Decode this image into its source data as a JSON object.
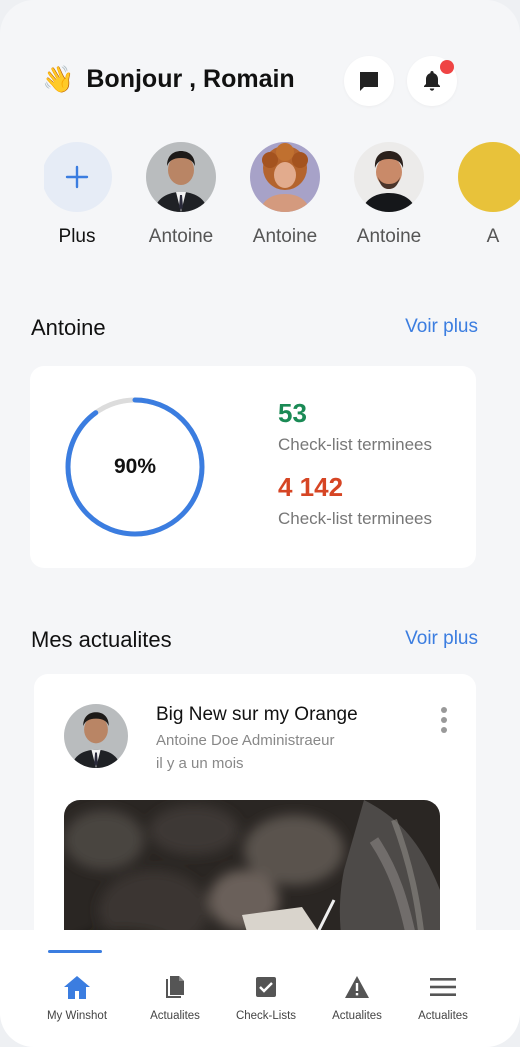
{
  "header": {
    "wave_emoji": "👋",
    "greeting": "Bonjour , Romain",
    "notification_dot_color": "#ef4444"
  },
  "stories": [
    {
      "label": "Plus",
      "type": "add"
    },
    {
      "label": "Antoine",
      "type": "avatar"
    },
    {
      "label": "Antoine",
      "type": "avatar"
    },
    {
      "label": "Antoine",
      "type": "avatar"
    },
    {
      "label": "A",
      "type": "avatar"
    }
  ],
  "stats_section": {
    "title": "Antoine",
    "see_more": "Voir plus",
    "progress_percent": 90,
    "progress_label": "90%",
    "stat1_value": "53",
    "stat1_label": "Check-list terminees",
    "stat2_value": "4 142",
    "stat2_label": "Check-list terminees"
  },
  "news_section": {
    "title": "Mes actualites",
    "see_more": "Voir plus",
    "item": {
      "title": "Big New sur my Orange",
      "author": "Antoine Doe Administraeur",
      "time": "il y a un mois"
    }
  },
  "bottom_nav": [
    {
      "label": "My Winshot",
      "icon": "home-icon",
      "active": true
    },
    {
      "label": "Actualites",
      "icon": "documents-icon",
      "active": false
    },
    {
      "label": "Check-Lists",
      "icon": "checkbox-icon",
      "active": false
    },
    {
      "label": "Actualites",
      "icon": "warning-icon",
      "active": false
    },
    {
      "label": "Actualites",
      "icon": "menu-icon",
      "active": false
    }
  ],
  "colors": {
    "accent": "#3b7de0",
    "green": "#1a8a55",
    "red": "#d64524"
  }
}
